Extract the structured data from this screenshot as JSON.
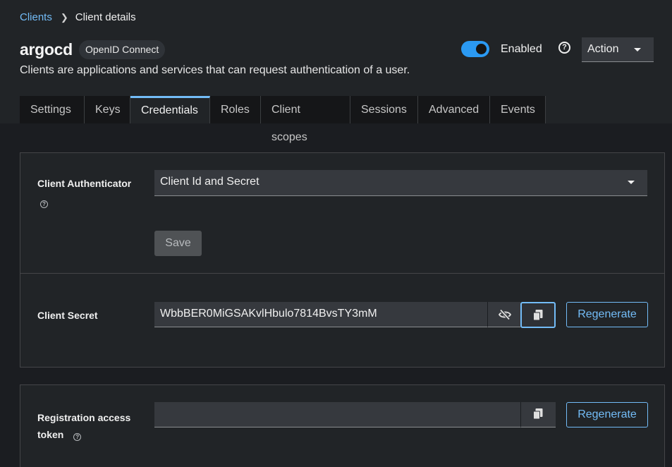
{
  "breadcrumb": {
    "parent": "Clients",
    "current": "Client details"
  },
  "client": {
    "name": "argocd",
    "protocol": "OpenID Connect",
    "description": "Clients are applications and services that can request authentication of a user."
  },
  "header": {
    "enabled_label": "Enabled",
    "enabled": true,
    "help_icon": "question-circle-icon",
    "action_label": "Action"
  },
  "tabs": [
    {
      "label": "Settings"
    },
    {
      "label": "Keys"
    },
    {
      "label": "Credentials",
      "active": true
    },
    {
      "label": "Roles"
    },
    {
      "label": "Client scopes"
    },
    {
      "label": "Sessions"
    },
    {
      "label": "Advanced"
    },
    {
      "label": "Events"
    }
  ],
  "credentials": {
    "authenticator_label": "Client Authenticator",
    "authenticator_value": "Client Id and Secret",
    "save_label": "Save",
    "secret_label": "Client Secret",
    "secret_value": "WbbBER0MiGSAKvlHbulo7814BvsTY3mM",
    "regenerate_label": "Regenerate",
    "registration_label_line1": "Registration access",
    "registration_label_line2": "token",
    "registration_value": "",
    "regenerate_token_label": "Regenerate"
  },
  "colors": {
    "accent": "#73bcf7",
    "toggle_on": "#2b9af3",
    "background": "#1b1d21"
  }
}
